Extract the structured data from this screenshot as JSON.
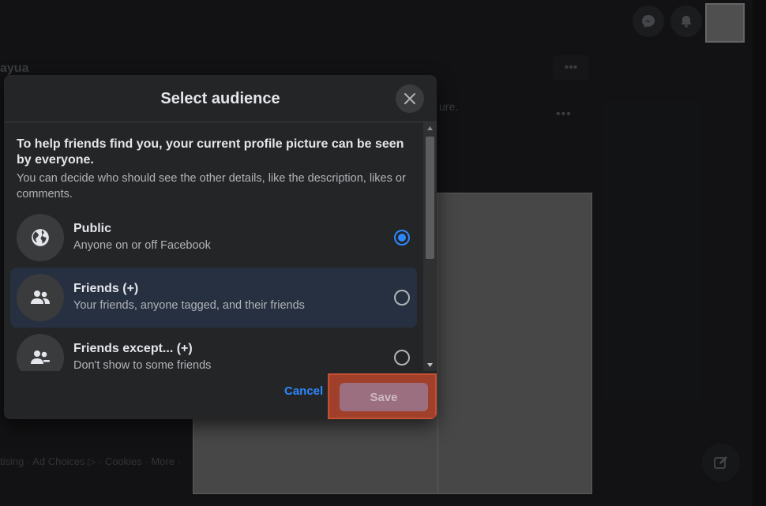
{
  "background": {
    "name_fragment": "ayua",
    "text_fragment": "ure.",
    "dots": "•••",
    "footer_text": "tising · Ad Choices ▷ · Cookies · More ·"
  },
  "dialog": {
    "title": "Select audience",
    "lead": "To help friends find you, your current profile picture can be seen by everyone.",
    "sub": "You can decide who should see the other details, like the description, likes or comments.",
    "options": [
      {
        "title": "Public",
        "description": "Anyone on or off Facebook",
        "icon": "globe-icon",
        "selected": true
      },
      {
        "title": "Friends (+)",
        "description": "Your friends, anyone tagged, and their friends",
        "icon": "friends-icon",
        "selected": false
      },
      {
        "title": "Friends except... (+)",
        "description": "Don't show to some friends",
        "icon": "friends-except-icon",
        "selected": false
      }
    ],
    "cancel_label": "Cancel",
    "save_label": "Save"
  },
  "colors": {
    "accent": "#2d88ff",
    "highlight": "#a0402b",
    "save_disabled": "#9b6f80"
  }
}
